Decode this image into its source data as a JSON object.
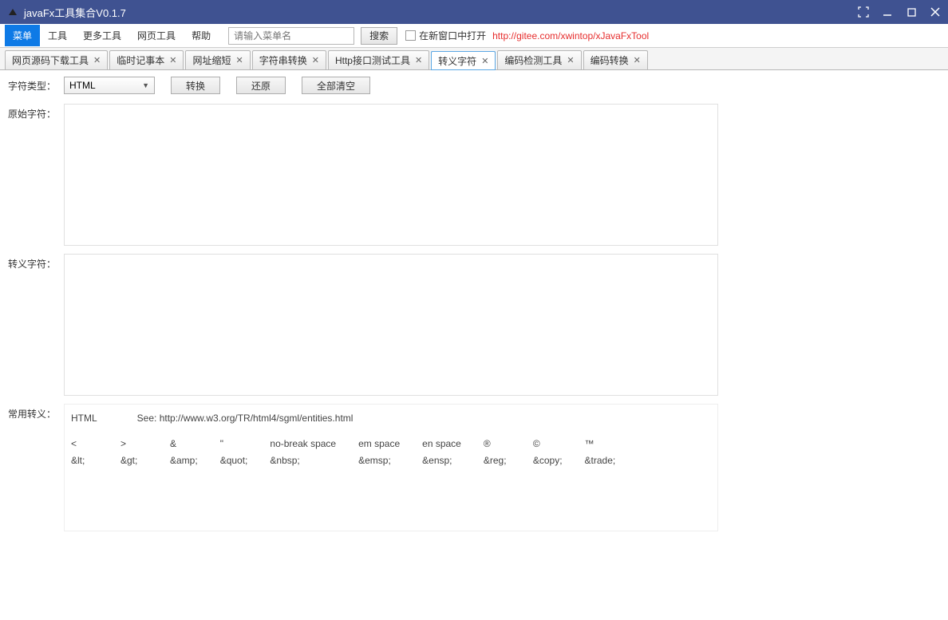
{
  "window": {
    "title": "javaFx工具集合V0.1.7"
  },
  "menu": {
    "items": [
      "菜单",
      "工具",
      "更多工具",
      "网页工具",
      "帮助"
    ],
    "search_placeholder": "请输入菜单名",
    "search_btn": "搜索",
    "checkbox_label": "在新窗口中打开",
    "link": "http://gitee.com/xwintop/xJavaFxTool"
  },
  "tabs": [
    {
      "label": "网页源码下载工具"
    },
    {
      "label": "临时记事本"
    },
    {
      "label": "网址缩短"
    },
    {
      "label": "字符串转换"
    },
    {
      "label": "Http接口测试工具"
    },
    {
      "label": "转义字符",
      "active": true
    },
    {
      "label": "编码检测工具"
    },
    {
      "label": "编码转换"
    }
  ],
  "form": {
    "type_label": "字符类型：",
    "type_value": "HTML",
    "btn_convert": "转换",
    "btn_restore": "还原",
    "btn_clear": "全部清空",
    "orig_label": "原始字符：",
    "escaped_label": "转义字符：",
    "ref_label": "常用转义："
  },
  "reference": {
    "head_left": "HTML",
    "head_right": "See: http://www.w3.org/TR/html4/sgml/entities.html",
    "cols": [
      {
        "char": "<",
        "code": "&lt;"
      },
      {
        "char": ">",
        "code": "&gt;"
      },
      {
        "char": "&",
        "code": "&amp;"
      },
      {
        "char": "\"",
        "code": "&quot;"
      },
      {
        "char": "no-break space",
        "code": "&nbsp;"
      },
      {
        "char": "em space",
        "code": "&emsp;"
      },
      {
        "char": "en space",
        "code": "&ensp;"
      },
      {
        "char": "®",
        "code": "&reg;"
      },
      {
        "char": "©",
        "code": "&copy;"
      },
      {
        "char": "™",
        "code": "&trade;"
      }
    ]
  }
}
